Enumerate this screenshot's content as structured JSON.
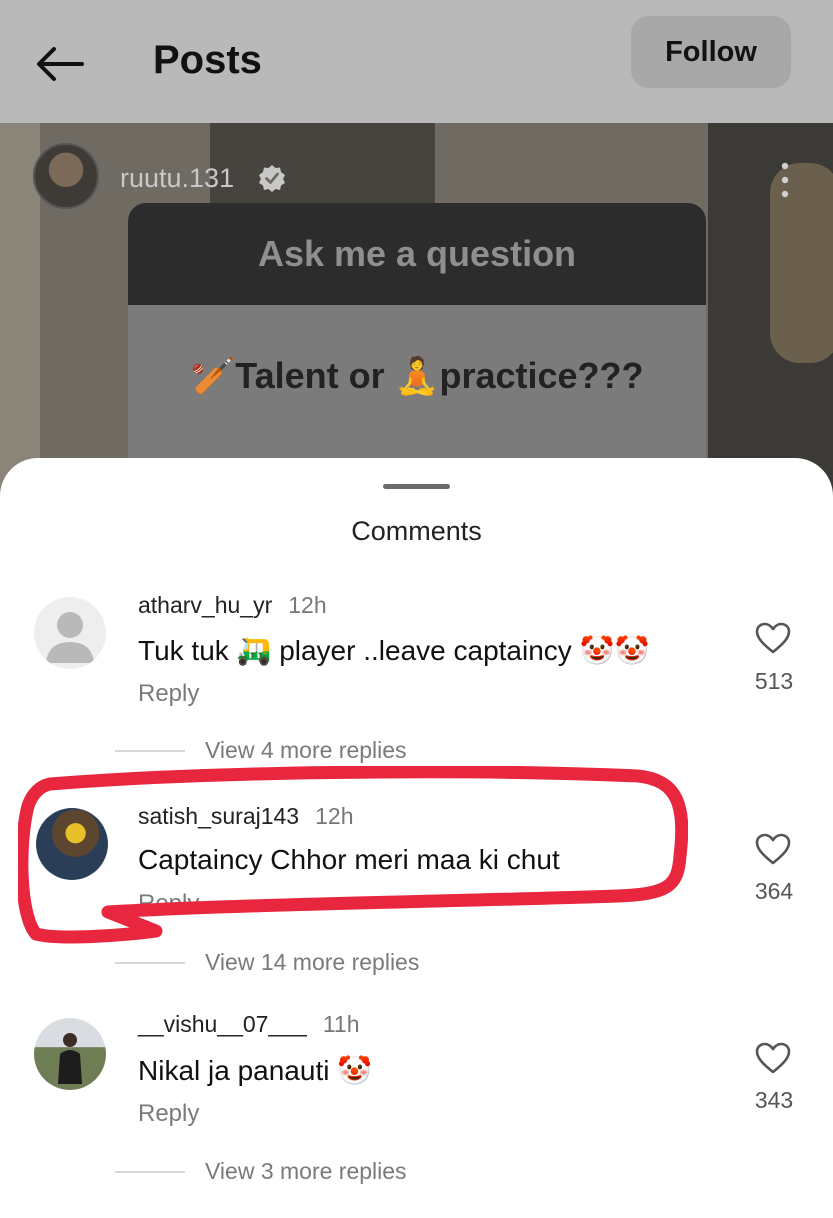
{
  "header": {
    "title": "Posts",
    "follow_label": "Follow"
  },
  "post": {
    "author": "ruutu.131",
    "question_title": "Ask me a question",
    "answer": "🏏Talent or 🧘practice???"
  },
  "sheet": {
    "title": "Comments"
  },
  "comments": [
    {
      "username": "atharv_hu_yr",
      "time": "12h",
      "text": "Tuk tuk 🛺 player ..leave captaincy 🤡🤡",
      "reply_label": "Reply",
      "likes": "513",
      "view_more": "View 4 more replies"
    },
    {
      "username": "satish_suraj143",
      "time": "12h",
      "text": "Captaincy Chhor meri maa ki chut",
      "reply_label": "Reply",
      "likes": "364",
      "view_more": "View 14 more replies"
    },
    {
      "username": "__vishu__07___",
      "time": "11h",
      "text": "Nikal ja panauti 🤡",
      "reply_label": "Reply",
      "likes": "343",
      "view_more": "View 3 more replies"
    }
  ],
  "colors": {
    "highlight": "#e8273f"
  }
}
